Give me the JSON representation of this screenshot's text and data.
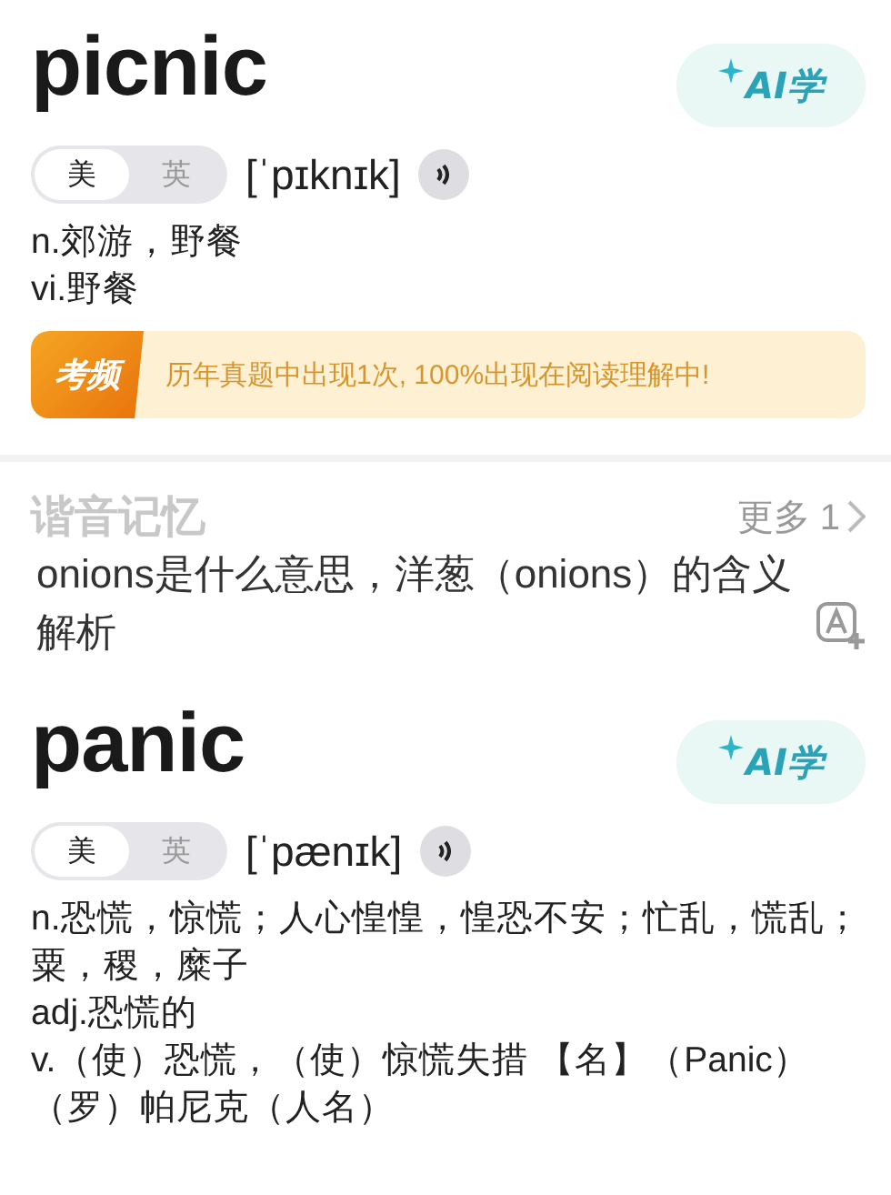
{
  "blocks": [
    {
      "kind": "entry",
      "word": "picnic",
      "ai_button": "AI学",
      "accents": [
        {
          "label": "美",
          "selected": true
        },
        {
          "label": "英",
          "selected": false
        }
      ],
      "phonetic": "[ˈpɪknɪk]",
      "definitions": [
        "n.郊游，野餐",
        "vi.野餐"
      ],
      "exam": {
        "badge": "考频",
        "text": "历年真题中出现1次, 100%出现在阅读理解中!"
      }
    },
    {
      "kind": "mnemonic",
      "heading": "谐音记忆",
      "more": "更多 1",
      "title": "onions是什么意思，洋葱（onions）的含义解析"
    },
    {
      "kind": "entry",
      "word": "panic",
      "ai_button": "AI学",
      "accents": [
        {
          "label": "美",
          "selected": true
        },
        {
          "label": "英",
          "selected": false
        }
      ],
      "phonetic": "[ˈpænɪk]",
      "definitions": [
        "n.恐慌，惊慌；人心惶惶，惶恐不安；忙乱，慌乱；粟，稷，糜子",
        "adj.恐慌的",
        "v.（使）恐慌，（使）惊慌失措 【名】（Panic）（罗）帕尼克（人名）"
      ]
    }
  ]
}
